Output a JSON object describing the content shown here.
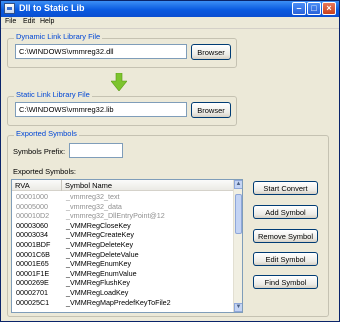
{
  "window": {
    "title": "Dll to Static Lib"
  },
  "menu": {
    "items": [
      "File",
      "Edit",
      "Help"
    ]
  },
  "dll_group": {
    "label": "Dynamic Link Library File",
    "path": "C:\\WINDOWS\\vmmreg32.dll",
    "browse_label": "Browser"
  },
  "lib_group": {
    "label": "Static Link Library File",
    "path": "C:\\WINDOWS\\vmmreg32.lib",
    "browse_label": "Browser"
  },
  "symbols_group": {
    "label": "Exported Symbols",
    "prefix_label": "Symbols Prefix:",
    "prefix_value": "",
    "list_label": "Exported Symbols:",
    "columns": [
      "RVA",
      "Symbol Name"
    ],
    "rows": [
      {
        "rva": "00001000",
        "name": "_vmmreg32_text",
        "disabled": true
      },
      {
        "rva": "00005000",
        "name": "_vmmreg32_data",
        "disabled": true
      },
      {
        "rva": "000010D2",
        "name": "_vmmreg32_DllEntryPoint@12",
        "disabled": true
      },
      {
        "rva": "00003060",
        "name": "_VMMRegCloseKey",
        "disabled": false
      },
      {
        "rva": "00003034",
        "name": "_VMMRegCreateKey",
        "disabled": false
      },
      {
        "rva": "00001BDF",
        "name": "_VMMRegDeleteKey",
        "disabled": false
      },
      {
        "rva": "00001C6B",
        "name": "_VMMRegDeleteValue",
        "disabled": false
      },
      {
        "rva": "00001E65",
        "name": "_VMMRegEnumKey",
        "disabled": false
      },
      {
        "rva": "00001F1E",
        "name": "_VMMRegEnumValue",
        "disabled": false
      },
      {
        "rva": "0000269E",
        "name": "_VMMRegFlushKey",
        "disabled": false
      },
      {
        "rva": "00002701",
        "name": "_VMMRegLoadKey",
        "disabled": false
      },
      {
        "rva": "000025C1",
        "name": "_VMMRegMapPredefKeyToFile2",
        "disabled": false
      }
    ]
  },
  "actions": {
    "start_convert": "Start Convert",
    "add_symbol": "Add Symbol",
    "remove_symbol": "Remove Symbol",
    "edit_symbol": "Edit Symbol",
    "find_symbol": "Find Symbol"
  },
  "colors": {
    "titlebar": "#0a5ae0",
    "group_label": "#0046d5",
    "arrow": "#7dc42e"
  },
  "icons": {
    "app": "app-icon",
    "arrow": "arrow-down-icon"
  }
}
